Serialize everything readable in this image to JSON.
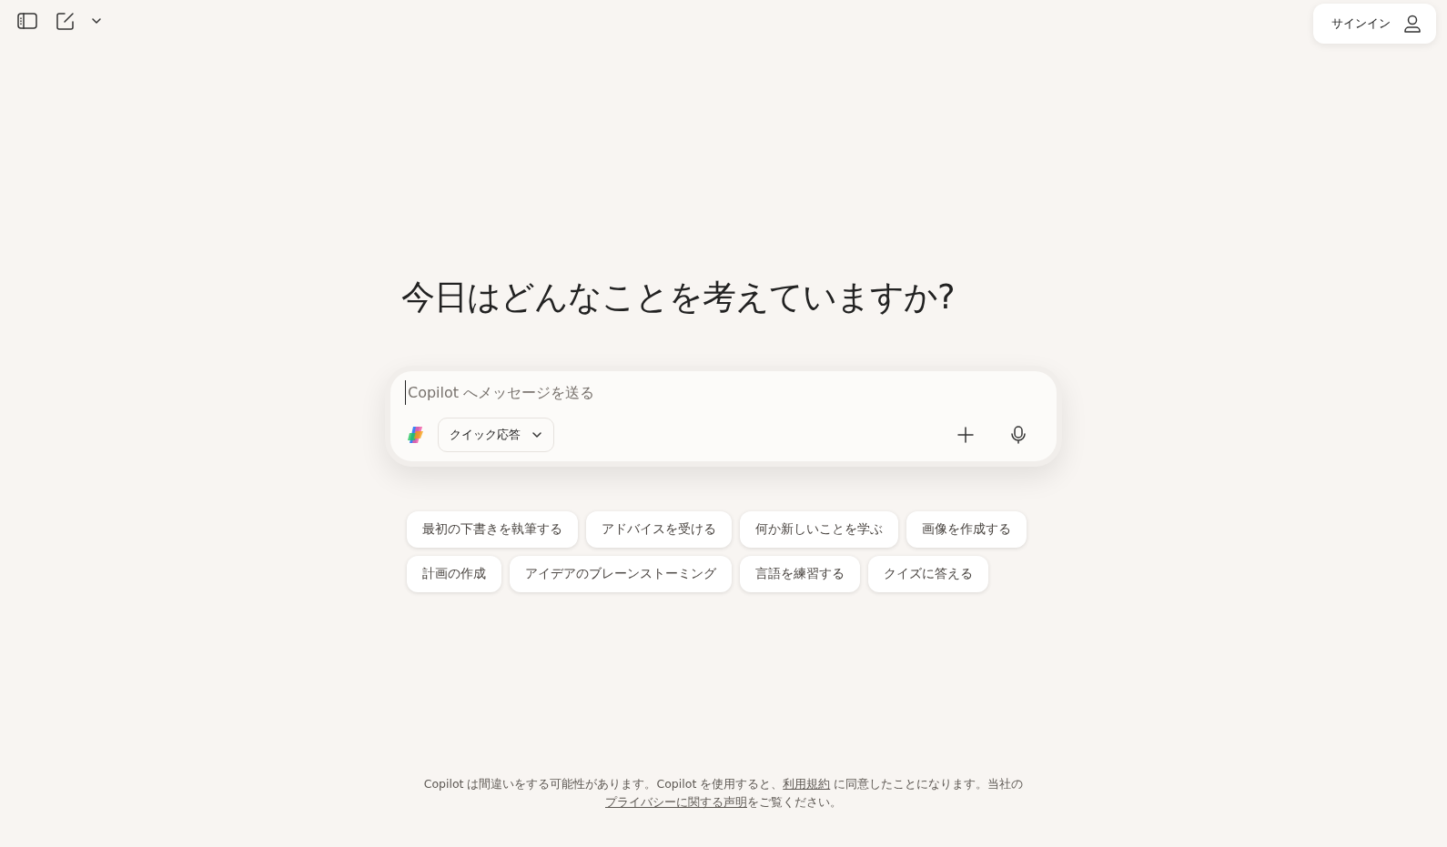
{
  "toolbar": {
    "sign_in": "サインイン"
  },
  "heading": "今日はどんなことを考えていますか?",
  "composer": {
    "placeholder": "Copilot へメッセージを送る",
    "mode": "クイック応答"
  },
  "suggestions": [
    [
      "最初の下書きを執筆する",
      "アドバイスを受ける",
      "何か新しいことを学ぶ",
      "画像を作成する"
    ],
    [
      "計画の作成",
      "アイデアのブレーンストーミング",
      "言語を練習する",
      "クイズに答える"
    ]
  ],
  "footer": [
    {
      "kind": "text",
      "text": "Copilot は間違いをする可能性があります。Copilot を使用すると、"
    },
    {
      "kind": "link",
      "text": "利用規約"
    },
    {
      "kind": "text",
      "text": " に同意したことになります。当社の"
    },
    {
      "kind": "link",
      "text": "プライバシーに関する声明"
    },
    {
      "kind": "text",
      "text": "をご覧ください。"
    }
  ]
}
